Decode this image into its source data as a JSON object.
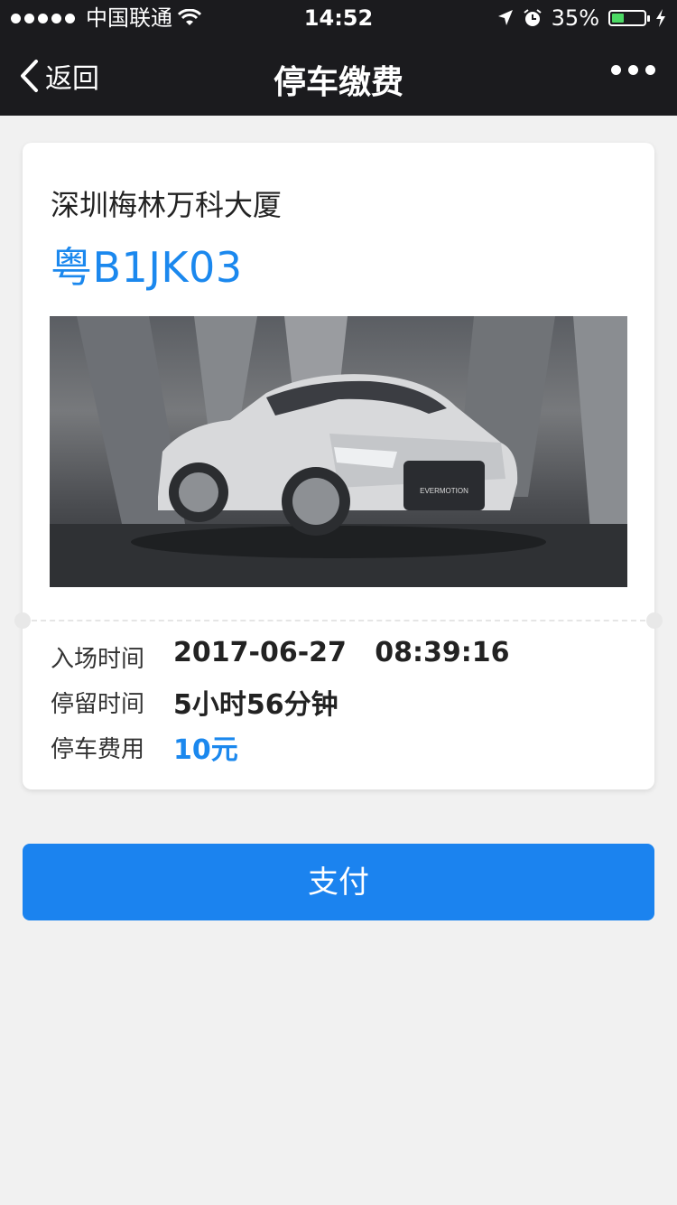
{
  "status_bar": {
    "carrier": "中国联通",
    "time": "14:52",
    "battery": "35%"
  },
  "nav": {
    "back_label": "返回",
    "title": "停车缴费"
  },
  "card": {
    "location": "深圳梅林万科大厦",
    "plate": "粤B1JK03",
    "photo_badge": "EVERMOTION",
    "rows": [
      {
        "label": "入场时间",
        "value": "2017-06-27   08:39:16"
      },
      {
        "label": "停留时间",
        "value": "5小时56分钟"
      },
      {
        "label": "停车费用",
        "value": "10元"
      }
    ]
  },
  "pay_button": {
    "label": "支付"
  },
  "colors": {
    "accent": "#1b88ee",
    "nav_bg": "#1b1b1e",
    "page_bg": "#f1f1f1"
  }
}
